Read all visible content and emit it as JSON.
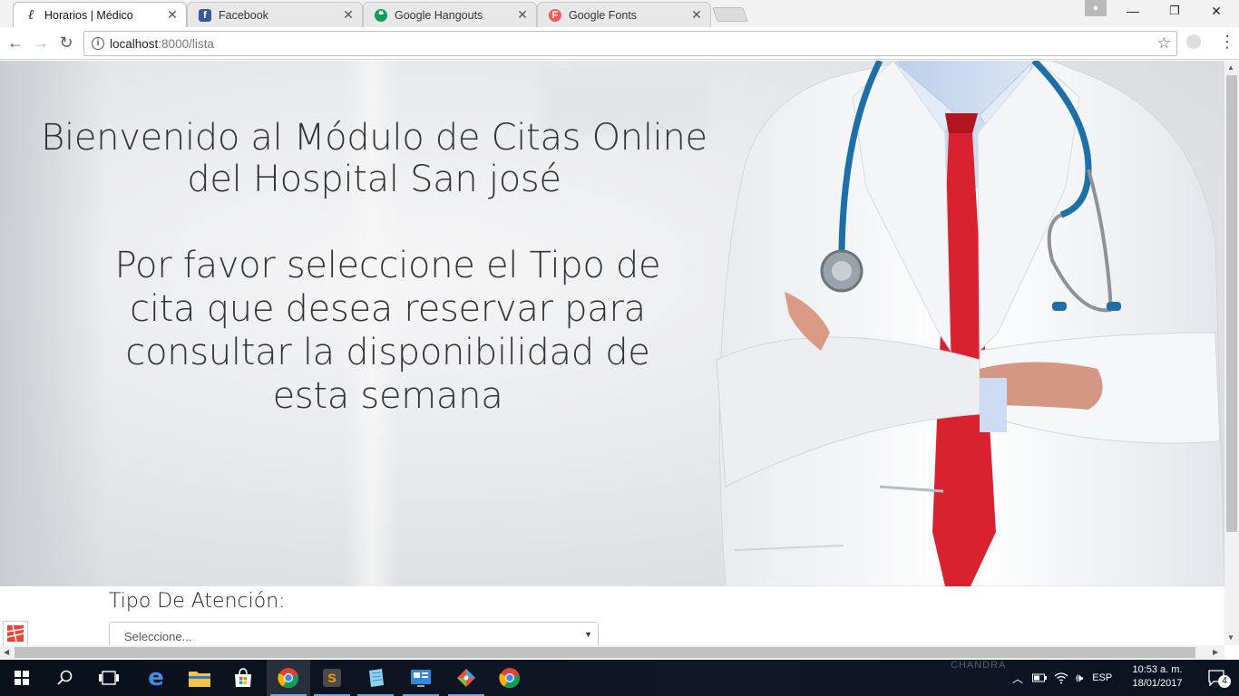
{
  "browser": {
    "tabs": [
      {
        "title": "Horarios | Médico",
        "icon": "script-l-icon",
        "active": true
      },
      {
        "title": "Facebook",
        "icon": "facebook-icon",
        "active": false
      },
      {
        "title": "Google Hangouts",
        "icon": "hangouts-icon",
        "active": false
      },
      {
        "title": "Google Fonts",
        "icon": "google-fonts-icon",
        "active": false
      }
    ],
    "url_host": "localhost",
    "url_path": ":8000/lista"
  },
  "hero": {
    "welcome": "Bienvenido al Módulo de Citas Online del Hospital San josé",
    "instruction": "Por favor seleccione el Tipo de cita que desea reservar para consultar la disponibilidad de esta semana"
  },
  "form": {
    "label": "Tipo De Atención:",
    "select_value": "Seleccione..."
  },
  "taskbar": {
    "watermark": "CHANDRA",
    "language": "ESP",
    "time": "10:53 a. m.",
    "date": "18/01/2017",
    "notifications": "4"
  },
  "colors": {
    "tab_active": "#ffffff",
    "taskbar": "#0b0f1a",
    "facebook": "#3b5998",
    "hangouts": "#0f9d58",
    "fonts": "#f15c5c",
    "tie": "#d8222f",
    "stethoscope": "#1d6fa8"
  }
}
